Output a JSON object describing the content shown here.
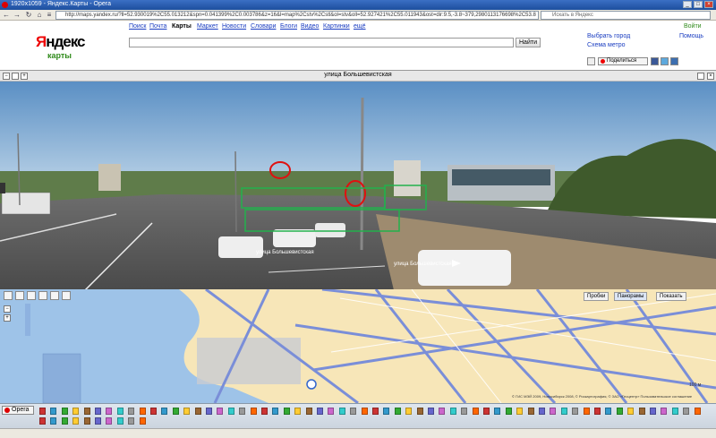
{
  "window": {
    "title": "1920x1059 - Яндекс.Карты - Opera"
  },
  "browser": {
    "address": "http://maps.yandex.ru/?ll=52.930019%2C55.013212&spn=0.041399%2C0.003786&z=16&l=map%2Cstv%2Cstl&ol=stv&oll=52.927421%2C55.011943&ost=dir:9.5,-3.8~379,2980113176698%2C53.8",
    "search_placeholder": "Искать в Яндекс"
  },
  "header": {
    "brand_first": "Я",
    "brand_rest": "ндекс",
    "product": "карты",
    "services": [
      "Поиск",
      "Почта",
      "Карты",
      "Маркет",
      "Новости",
      "Словари",
      "Блоги",
      "Видео",
      "Картинки",
      "ещё"
    ],
    "find_button": "Найти",
    "login": "Войти",
    "help": "Помощь",
    "choose_city": "Выбрать город",
    "metro": "Схема метро",
    "share": "Поделиться"
  },
  "panorama": {
    "title": "улица Большевистская",
    "street_label_left": "улица Большевистская",
    "street_label_right": "улица Большевистская"
  },
  "map": {
    "traffic": "Пробки",
    "panoramas": "Панорамы",
    "show": "Показать",
    "copyright": "© ГИС МЭЙ 2009, Новосибирск 2008, © Роскартография, © ЗАО «Геоцентр»   Пользовательское соглашение",
    "scale": "100 м"
  },
  "taskbar": {
    "opera": "Opera"
  }
}
